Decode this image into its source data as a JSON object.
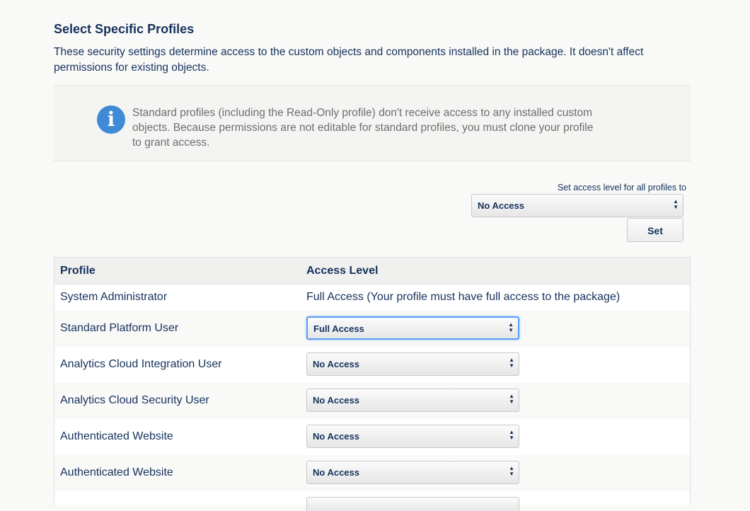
{
  "page": {
    "title": "Select Specific Profiles",
    "description": "These security settings determine access to the custom objects and components installed in the package. It doesn't affect permissions for existing objects."
  },
  "info": {
    "icon": "info-icon",
    "text": "Standard profiles (including the Read-Only profile) don't receive access to any installed custom objects. Because permissions are not editable for standard profiles, you must clone your profile to grant access."
  },
  "bulk": {
    "label": "Set access level for all profiles to",
    "selected": "No Access",
    "set_label": "Set"
  },
  "table": {
    "headers": [
      "Profile",
      "Access Level"
    ],
    "rows": [
      {
        "profile": "System Administrator",
        "access": "Full Access (Your profile must have full access to the package)"
      },
      {
        "profile": "Standard Platform User",
        "access": "Full Access"
      },
      {
        "profile": "Analytics Cloud Integration User",
        "access": "No Access"
      },
      {
        "profile": "Analytics Cloud Security User",
        "access": "No Access"
      },
      {
        "profile": "Authenticated Website",
        "access": "No Access"
      },
      {
        "profile": "Authenticated Website",
        "access": "No Access"
      }
    ]
  },
  "colors": {
    "text": "#16325c",
    "info_icon": "#3e8ad4",
    "focus": "#5b9ef5"
  }
}
